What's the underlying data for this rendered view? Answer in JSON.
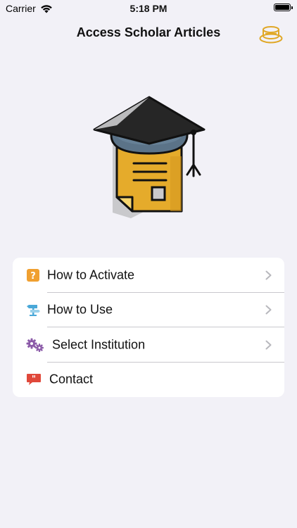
{
  "status_bar": {
    "carrier": "Carrier",
    "time": "5:18 PM"
  },
  "nav": {
    "title": "Access Scholar Articles",
    "right_icon": "coffee-cup-icon"
  },
  "hero": {
    "icon": "graduation-cap-document-icon"
  },
  "colors": {
    "background": "#f2f1f7",
    "accent": "#e0a725",
    "card": "#ffffff"
  },
  "menu": {
    "items": [
      {
        "label": "How to Activate",
        "icon": "question-mark-icon",
        "icon_color": "#f0a030",
        "has_chevron": true
      },
      {
        "label": "How to Use",
        "icon": "signpost-icon",
        "icon_color": "#4aa8d8",
        "has_chevron": true
      },
      {
        "label": "Select Institution",
        "icon": "gears-icon",
        "icon_color": "#8b5aa8",
        "has_chevron": true
      },
      {
        "label": "Contact",
        "icon": "speech-bubble-quote-icon",
        "icon_color": "#e0483a",
        "has_chevron": false
      }
    ]
  }
}
